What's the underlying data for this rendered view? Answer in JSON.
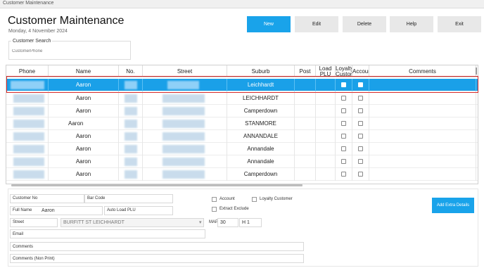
{
  "window": {
    "title": "Customer Maintenance"
  },
  "header": {
    "title": "Customer Maintenance",
    "date": "Monday, 4 November 2024"
  },
  "toolbar": {
    "new": "New",
    "edit": "Edit",
    "delete": "Delete",
    "help": "Help",
    "exit": "Exit"
  },
  "search": {
    "legend": "Customer Search",
    "placeholder": "CustomerPhone"
  },
  "grid": {
    "columns": [
      "Phone",
      "Name",
      "No.",
      "Street",
      "Suburb",
      "Post",
      "Load PLU",
      "Loyalty Custom",
      "Accour",
      "Comments"
    ],
    "rows": [
      {
        "name": "Aaron",
        "suburb": "Leichhardt",
        "selected": true
      },
      {
        "name": "Aaron",
        "suburb": "LEICHHARDT"
      },
      {
        "name": "Aaron",
        "suburb": "Camperdown"
      },
      {
        "name": "Aaron",
        "suburb": "STANMORE"
      },
      {
        "name": "Aaron",
        "suburb": "ANNANDALE"
      },
      {
        "name": "Aaron",
        "suburb": "Annandale"
      },
      {
        "name": "Aaron",
        "suburb": "Annandale"
      },
      {
        "name": "Aaron",
        "suburb": "Camperdown"
      }
    ]
  },
  "detail": {
    "customer_no_label": "Customer No",
    "bar_code_label": "Bar Code",
    "full_name_label": "Full Name",
    "full_name_value": "Aaron",
    "auto_load_plu_label": "Auto Load PLU",
    "street_label": "Street",
    "street_value": "BURFITT ST LEICHHARDT",
    "map_label": "MAP",
    "map_value": "30",
    "map_grid_value": "H 1",
    "email_label": "Email",
    "comments_label": "Comments",
    "comments_nonprint_label": "Comments (Non Print)",
    "account_label": "Account",
    "loyalty_label": "Loyalty Customer",
    "extract_exclude_label": "Extract Exclude",
    "extra_details_button": "Add Extra Details"
  }
}
